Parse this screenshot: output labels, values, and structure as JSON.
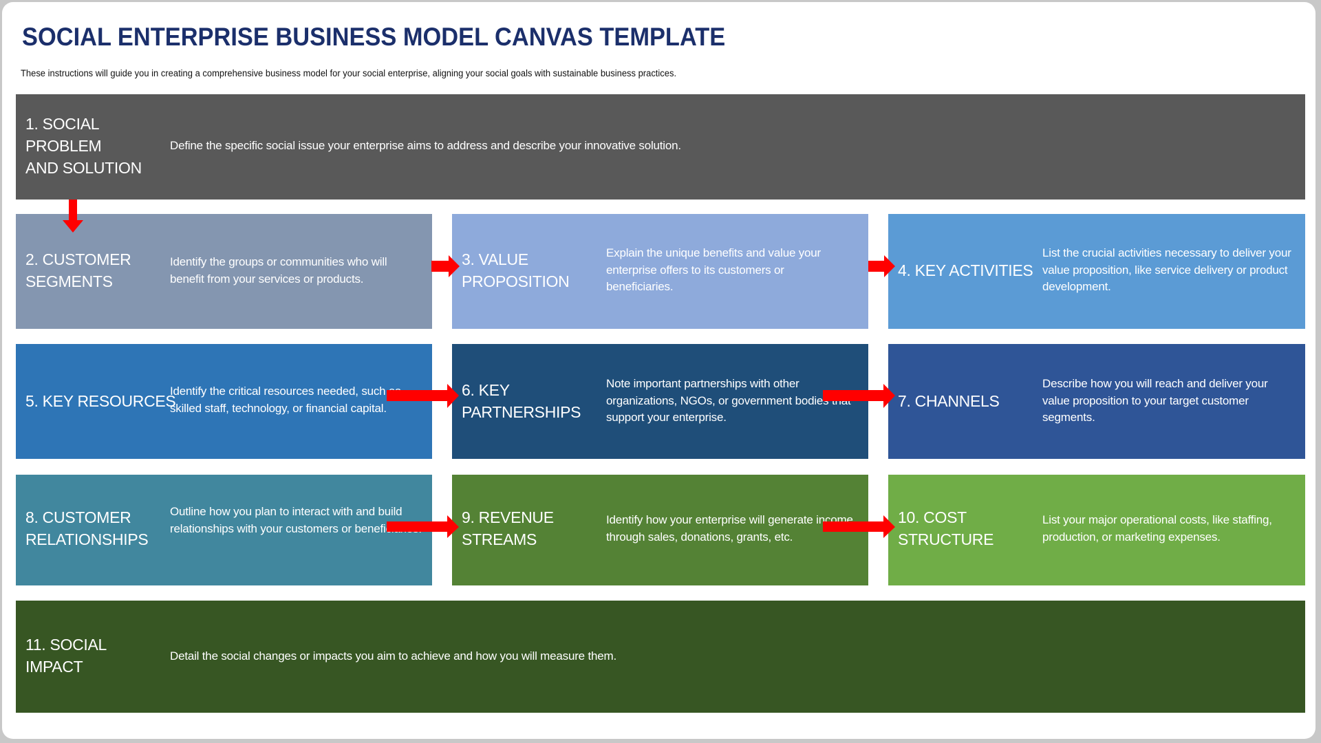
{
  "title": "SOCIAL ENTERPRISE BUSINESS MODEL CANVAS TEMPLATE",
  "subtitle": "These instructions will guide you in creating a comprehensive business model for your social enterprise, aligning your social goals with sustainable business practices.",
  "colors": {
    "title": "#1b2f6b",
    "arrow": "#ff0000",
    "social_problem": "#595959",
    "customer_segments": "#8496b0",
    "value_proposition": "#8eaadb",
    "key_activities": "#5b9bd5",
    "key_resources": "#2e75b6",
    "key_partnerships": "#1f4e79",
    "channels": "#2f5597",
    "customer_relationships": "#41879e",
    "revenue_streams": "#548235",
    "cost_structure": "#70ad47",
    "social_impact": "#375623"
  },
  "sections": {
    "social_problem": {
      "heading": "1. SOCIAL\nPROBLEM\nAND SOLUTION",
      "description": "Define the specific social issue your enterprise aims to address and describe your innovative solution."
    },
    "customer_segments": {
      "heading": "2. CUSTOMER\nSEGMENTS",
      "description": "Identify the groups or communities who will benefit from your services or products."
    },
    "value_proposition": {
      "heading": "3. VALUE\nPROPOSITION",
      "description": "Explain the unique benefits and value your enterprise offers to its customers or beneficiaries."
    },
    "key_activities": {
      "heading": "4. KEY ACTIVITIES",
      "description": "List the crucial activities necessary to deliver your value proposition, like service delivery or product development."
    },
    "key_resources": {
      "heading": "5. KEY RESOURCES",
      "description": "Identify the critical resources needed, such as skilled staff, technology, or financial capital."
    },
    "key_partnerships": {
      "heading": "6. KEY\nPARTNERSHIPS",
      "description": "Note important partnerships with other organizations, NGOs, or government bodies that support your enterprise."
    },
    "channels": {
      "heading": "7. CHANNELS",
      "description": "Describe how you will reach and deliver your value proposition to your target customer segments."
    },
    "customer_relationships": {
      "heading": "8. CUSTOMER\nRELATIONSHIPS",
      "description": "Outline how you plan to interact with and build relationships with your customers or beneficiaries."
    },
    "revenue_streams": {
      "heading": "9. REVENUE\nSTREAMS",
      "description": "Identify how your enterprise will generate income through sales, donations, grants, etc."
    },
    "cost_structure": {
      "heading": "10. COST\nSTRUCTURE",
      "description": "List your major operational costs, like staffing, production, or marketing expenses."
    },
    "social_impact": {
      "heading": "11. SOCIAL\nIMPACT",
      "description": "Detail the social changes or impacts you aim to achieve and how you will measure them."
    }
  },
  "arrows": [
    {
      "from": "1",
      "to": "2",
      "direction": "down"
    },
    {
      "from": "2",
      "to": "3",
      "direction": "right"
    },
    {
      "from": "3",
      "to": "4",
      "direction": "right"
    },
    {
      "from": "5",
      "to": "6",
      "direction": "right"
    },
    {
      "from": "6",
      "to": "7",
      "direction": "right"
    },
    {
      "from": "8",
      "to": "9",
      "direction": "right"
    },
    {
      "from": "9",
      "to": "10",
      "direction": "right"
    }
  ]
}
